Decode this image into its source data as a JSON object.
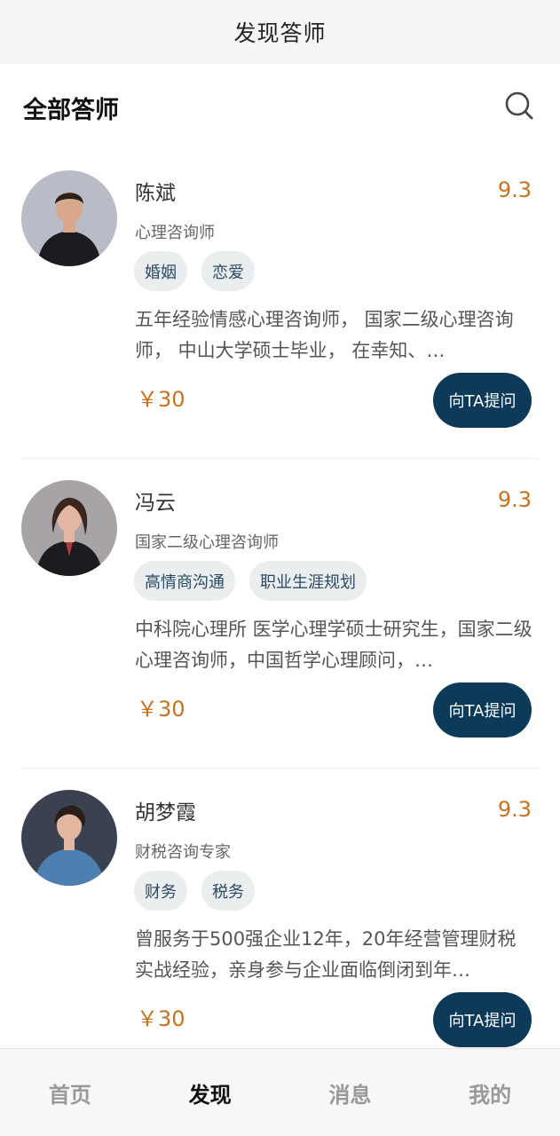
{
  "header": {
    "title": "发现答师"
  },
  "section": {
    "title": "全部答师",
    "search_icon": "search-icon"
  },
  "counselors": [
    {
      "name": "陈斌",
      "score": "9.3",
      "role": "心理咨询师",
      "tags": [
        "婚姻",
        "恋爱"
      ],
      "description": "五年经验情感心理咨询师， 国家二级心理咨询师， 中山大学硕士毕业， 在幸知、…",
      "price": "￥30",
      "ask_label": "向TA提问",
      "avatar_colors": {
        "bg": "#b9bcc6",
        "shirt": "#1c1c20",
        "skin": "#d9a78c",
        "hair": "#2a211d"
      }
    },
    {
      "name": "冯云",
      "score": "9.3",
      "role": "国家二级心理咨询师",
      "tags": [
        "高情商沟通",
        "职业生涯规划"
      ],
      "description": "中科院心理所 医学心理学硕士研究生，国家二级心理咨询师，中国哲学心理顾问，…",
      "price": "￥30",
      "ask_label": "向TA提问",
      "avatar_colors": {
        "bg": "#a7a3a6",
        "shirt": "#1b1b20",
        "skin": "#e3b6a1",
        "hair": "#3a2621"
      }
    },
    {
      "name": "胡梦霞",
      "score": "9.3",
      "role": "财税咨询专家",
      "tags": [
        "财务",
        "税务"
      ],
      "description": "曾服务于500强企业12年，20年经营管理财税实战经验，亲身参与企业面临倒闭到年…",
      "price": "￥30",
      "ask_label": "向TA提问",
      "avatar_colors": {
        "bg": "#3a4150",
        "shirt": "#4d7fb0",
        "skin": "#e2b69f",
        "hair": "#2b1d19"
      }
    }
  ],
  "tabbar": [
    {
      "label": "首页",
      "active": false
    },
    {
      "label": "发现",
      "active": true
    },
    {
      "label": "消息",
      "active": false
    },
    {
      "label": "我的",
      "active": false
    }
  ]
}
